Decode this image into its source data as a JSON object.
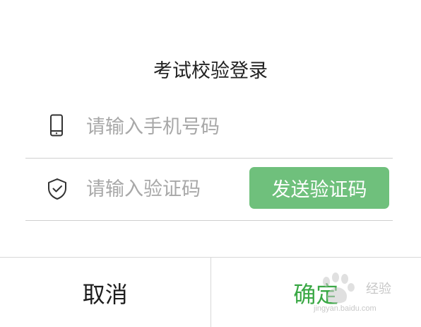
{
  "dialog": {
    "title": "考试校验登录",
    "phone": {
      "icon": "mobile-phone-icon",
      "placeholder": "请输入手机号码",
      "value": ""
    },
    "code": {
      "icon": "shield-check-icon",
      "placeholder": "请输入验证码",
      "value": "",
      "send_label": "发送验证码"
    },
    "footer": {
      "cancel_label": "取消",
      "confirm_label": "确定"
    }
  },
  "watermark": {
    "text": "经验",
    "url": "jingyan.baidu.com"
  },
  "colors": {
    "accent": "#6fc07c",
    "confirm_text": "#3aa845",
    "placeholder": "#a8a8a8",
    "divider": "#cfcfcf"
  }
}
